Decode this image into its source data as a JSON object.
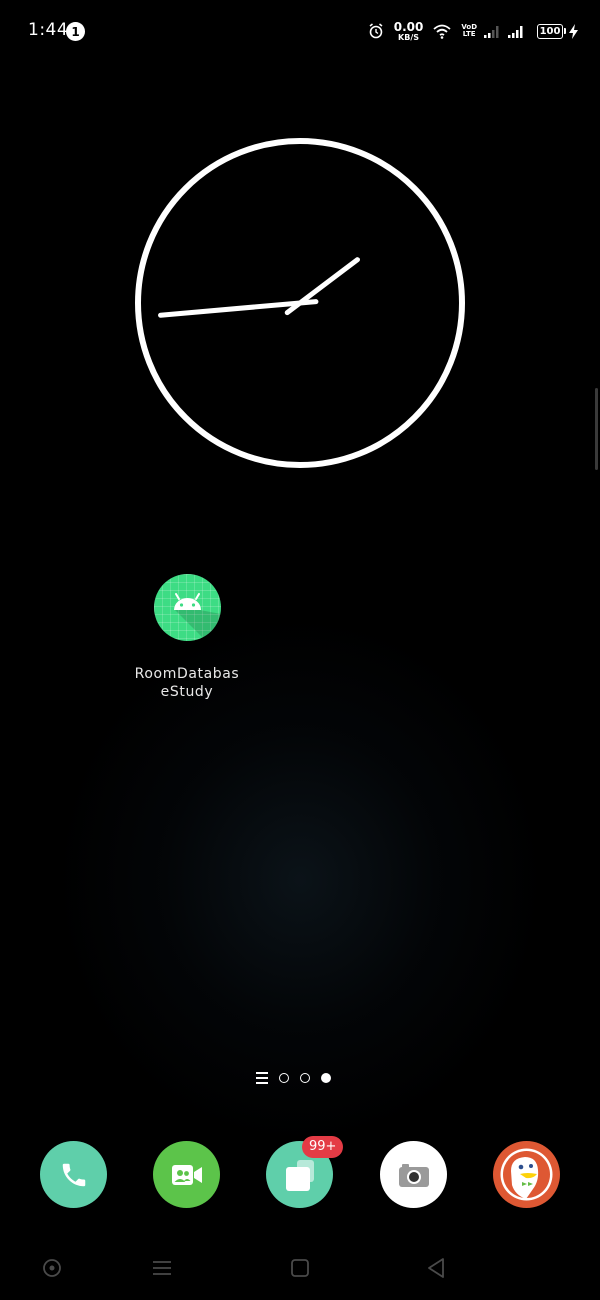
{
  "status_bar": {
    "time": "1:44",
    "notification_count": "1",
    "net_speed_value": "0.00",
    "net_speed_unit": "KB/S",
    "volte_top": "VoD",
    "volte_bottom": "LTE",
    "battery": "100"
  },
  "clock": {
    "hour_hand_angle_deg": 53,
    "minute_hand_angle_deg": 265
  },
  "app": {
    "label": "RoomDatabaseStudy",
    "icon": "android-icon",
    "icon_color": "#3ddc84"
  },
  "page_indicator": {
    "pages": 3,
    "active_page": 3
  },
  "dock": {
    "apps": [
      {
        "name": "phone",
        "icon": "phone-icon",
        "color": "#5fcfaa"
      },
      {
        "name": "video-call",
        "icon": "video-call-icon",
        "color": "#5cc44a"
      },
      {
        "name": "messages",
        "icon": "messages-icon",
        "color": "#5fcfaa"
      },
      {
        "name": "camera",
        "icon": "camera-icon",
        "color": "#ffffff"
      },
      {
        "name": "duckduckgo",
        "icon": "duck-icon",
        "color": "#de5833"
      }
    ],
    "badge": "99+"
  },
  "nav_bar": {
    "buttons": [
      "assistant",
      "menu",
      "home",
      "back"
    ]
  }
}
